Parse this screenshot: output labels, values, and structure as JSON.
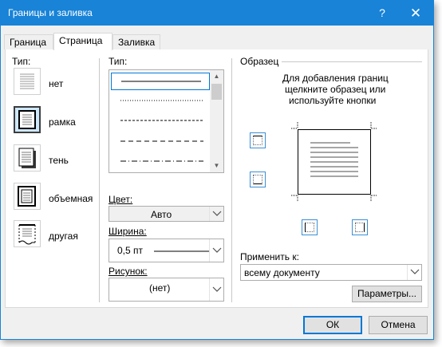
{
  "window": {
    "title": "Границы и заливка",
    "help_label": "?",
    "close_label": "✕"
  },
  "tabs": [
    {
      "label": "Граница"
    },
    {
      "label": "Страница"
    },
    {
      "label": "Заливка"
    }
  ],
  "type_section": {
    "heading": "Тип:",
    "options": [
      {
        "label": "нет"
      },
      {
        "label": "рамка"
      },
      {
        "label": "тень"
      },
      {
        "label": "объемная"
      },
      {
        "label": "другая"
      }
    ],
    "selected": "рамка"
  },
  "style_section": {
    "heading": "Тип:",
    "line_styles": [
      "solid",
      "dotted",
      "dashed-small",
      "dashed",
      "dash-dot"
    ],
    "selected_style": "solid"
  },
  "color": {
    "label": "Цвет:",
    "value": "Авто"
  },
  "width": {
    "label": "Ширина:",
    "value": "0,5 пт"
  },
  "art": {
    "label": "Рисунок:",
    "value": "(нет)"
  },
  "preview": {
    "heading": "Образец",
    "instructions_line1": "Для добавления границ",
    "instructions_line2": "щелкните образец или",
    "instructions_line3": "используйте кнопки"
  },
  "apply_to": {
    "label": "Применить к:",
    "value": "всему документу"
  },
  "buttons": {
    "options": "Параметры...",
    "ok": "ОК",
    "cancel": "Отмена"
  },
  "colors": {
    "titlebar": "#1883d7",
    "selection": "#cde8ff",
    "focus": "#0078d7"
  }
}
